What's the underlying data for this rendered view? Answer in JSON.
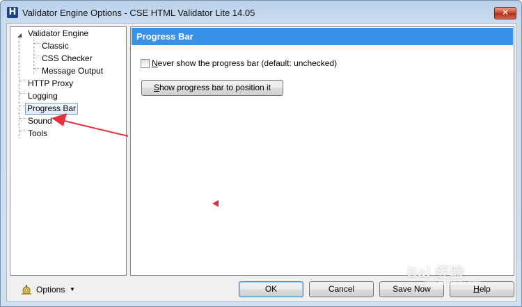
{
  "window": {
    "title": "Validator Engine Options - CSE HTML Validator Lite 14.05",
    "icon": "H",
    "close_label": "✕"
  },
  "tree": {
    "items": [
      {
        "label": "Validator Engine",
        "expanded": true
      },
      {
        "label": "Classic"
      },
      {
        "label": "CSS Checker"
      },
      {
        "label": "Message Output"
      },
      {
        "label": "HTTP Proxy"
      },
      {
        "label": "Logging"
      },
      {
        "label": "Progress Bar",
        "selected": true
      },
      {
        "label": "Sound"
      },
      {
        "label": "Tools"
      }
    ]
  },
  "panel": {
    "header": "Progress Bar",
    "checkbox": {
      "label_underlined": "N",
      "label_rest": "ever show the progress bar (default: unchecked)",
      "checked": false
    },
    "show_button": {
      "underlined": "S",
      "rest": "how progress bar to position it"
    }
  },
  "footer": {
    "options_label": "Options",
    "ok_label": "OK",
    "cancel_label": "Cancel",
    "save_now_label": "Save Now",
    "help_underlined": "H",
    "help_rest": "elp"
  },
  "watermark": {
    "text": "Bai 经验",
    "sub": "jingyan.baidu.com"
  },
  "colors": {
    "header_bg": "#3a92e8",
    "annotation_arrow": "#e8303a",
    "close_button": "#c7422a"
  }
}
